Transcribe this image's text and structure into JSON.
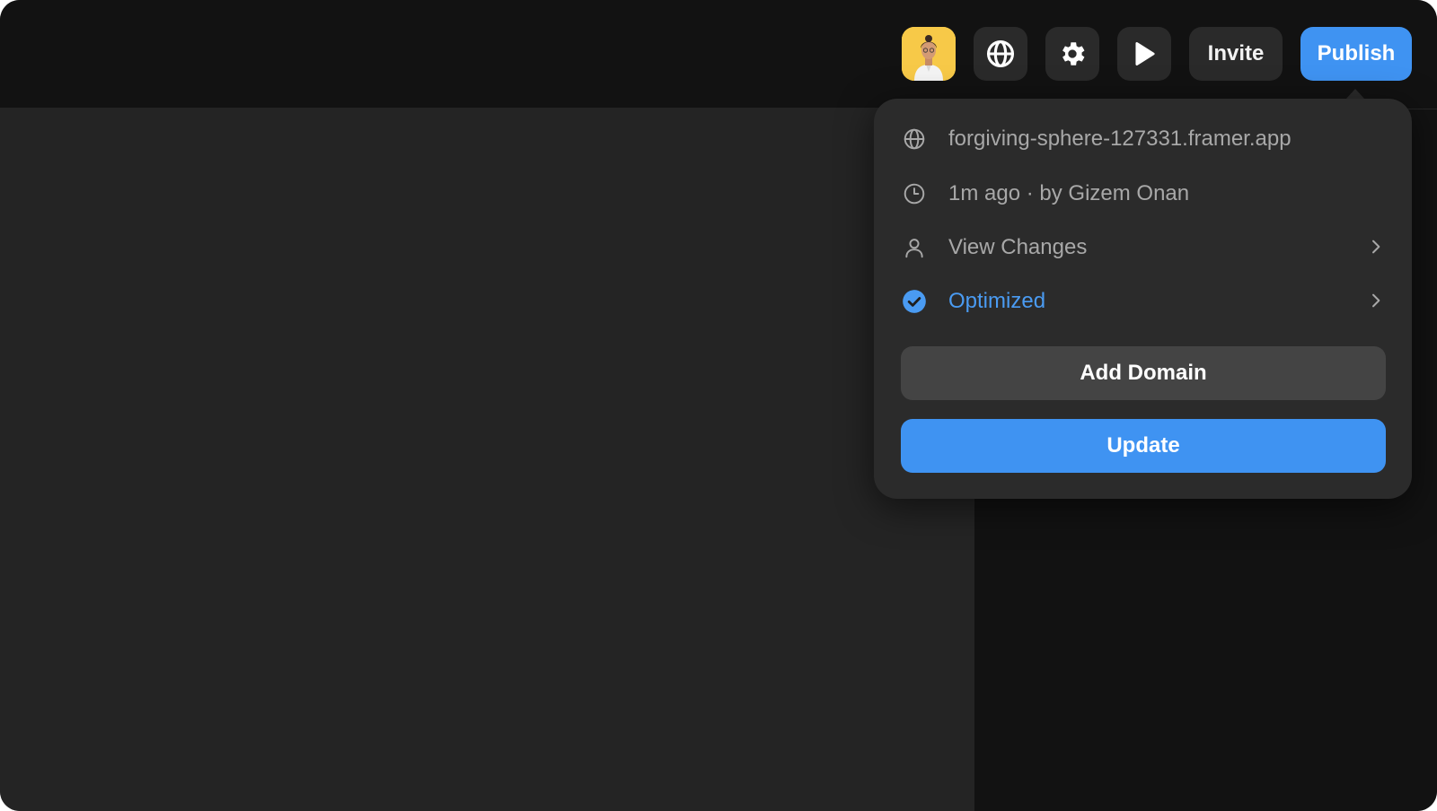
{
  "toolbar": {
    "avatar_icon": "user-avatar-photo",
    "globe_icon": "globe-icon",
    "settings_icon": "gear-icon",
    "preview_icon": "play-icon",
    "invite_label": "Invite",
    "publish_label": "Publish"
  },
  "publish_popover": {
    "url": "forgiving-sphere-127331.framer.app",
    "last_published": "1m ago · by Gizem Onan",
    "view_changes_label": "View Changes",
    "optimized_label": "Optimized",
    "add_domain_label": "Add Domain",
    "update_label": "Update"
  },
  "colors": {
    "accent": "#3f93f2",
    "optimized_text": "#4a9bf2",
    "avatar_bg": "#f7c948",
    "canvas_bg": "#242424",
    "chrome_bg": "#121212",
    "popover_bg": "#2b2b2b"
  }
}
